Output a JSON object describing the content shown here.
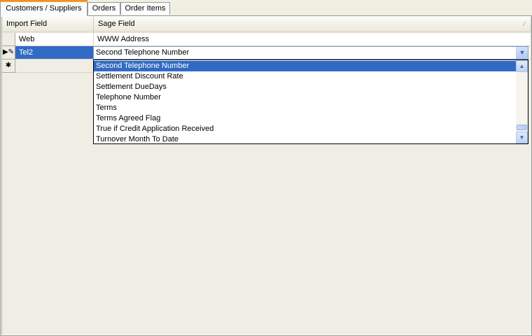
{
  "tabs": [
    {
      "label": "Customers / Suppliers",
      "active": true
    },
    {
      "label": "Orders",
      "active": false
    },
    {
      "label": "Order Items",
      "active": false
    }
  ],
  "grid": {
    "columns": [
      "Import Field",
      "Sage Field"
    ],
    "rows": [
      {
        "import_field": "Web",
        "sage_field": "WWW Address",
        "indicator": ""
      },
      {
        "import_field": "Tel2",
        "sage_field": "Second Telephone Number",
        "indicator": "▶✎"
      },
      {
        "import_field": "",
        "sage_field": "",
        "indicator": "✱"
      }
    ]
  },
  "combo": {
    "value": "Second Telephone Number",
    "button_icon": "▼"
  },
  "dropdown": {
    "options": [
      "Second Telephone Number",
      "Settlement Discount Rate",
      "Settlement DueDays",
      "Telephone Number",
      "Terms",
      "Terms Agreed Flag",
      "True if Credit Application Received",
      "Turnover Month To Date"
    ],
    "highlighted": "Second Telephone Number",
    "scroll_up_icon": "▲",
    "scroll_down_icon": "▼"
  },
  "header_sort_icon": "⁄"
}
